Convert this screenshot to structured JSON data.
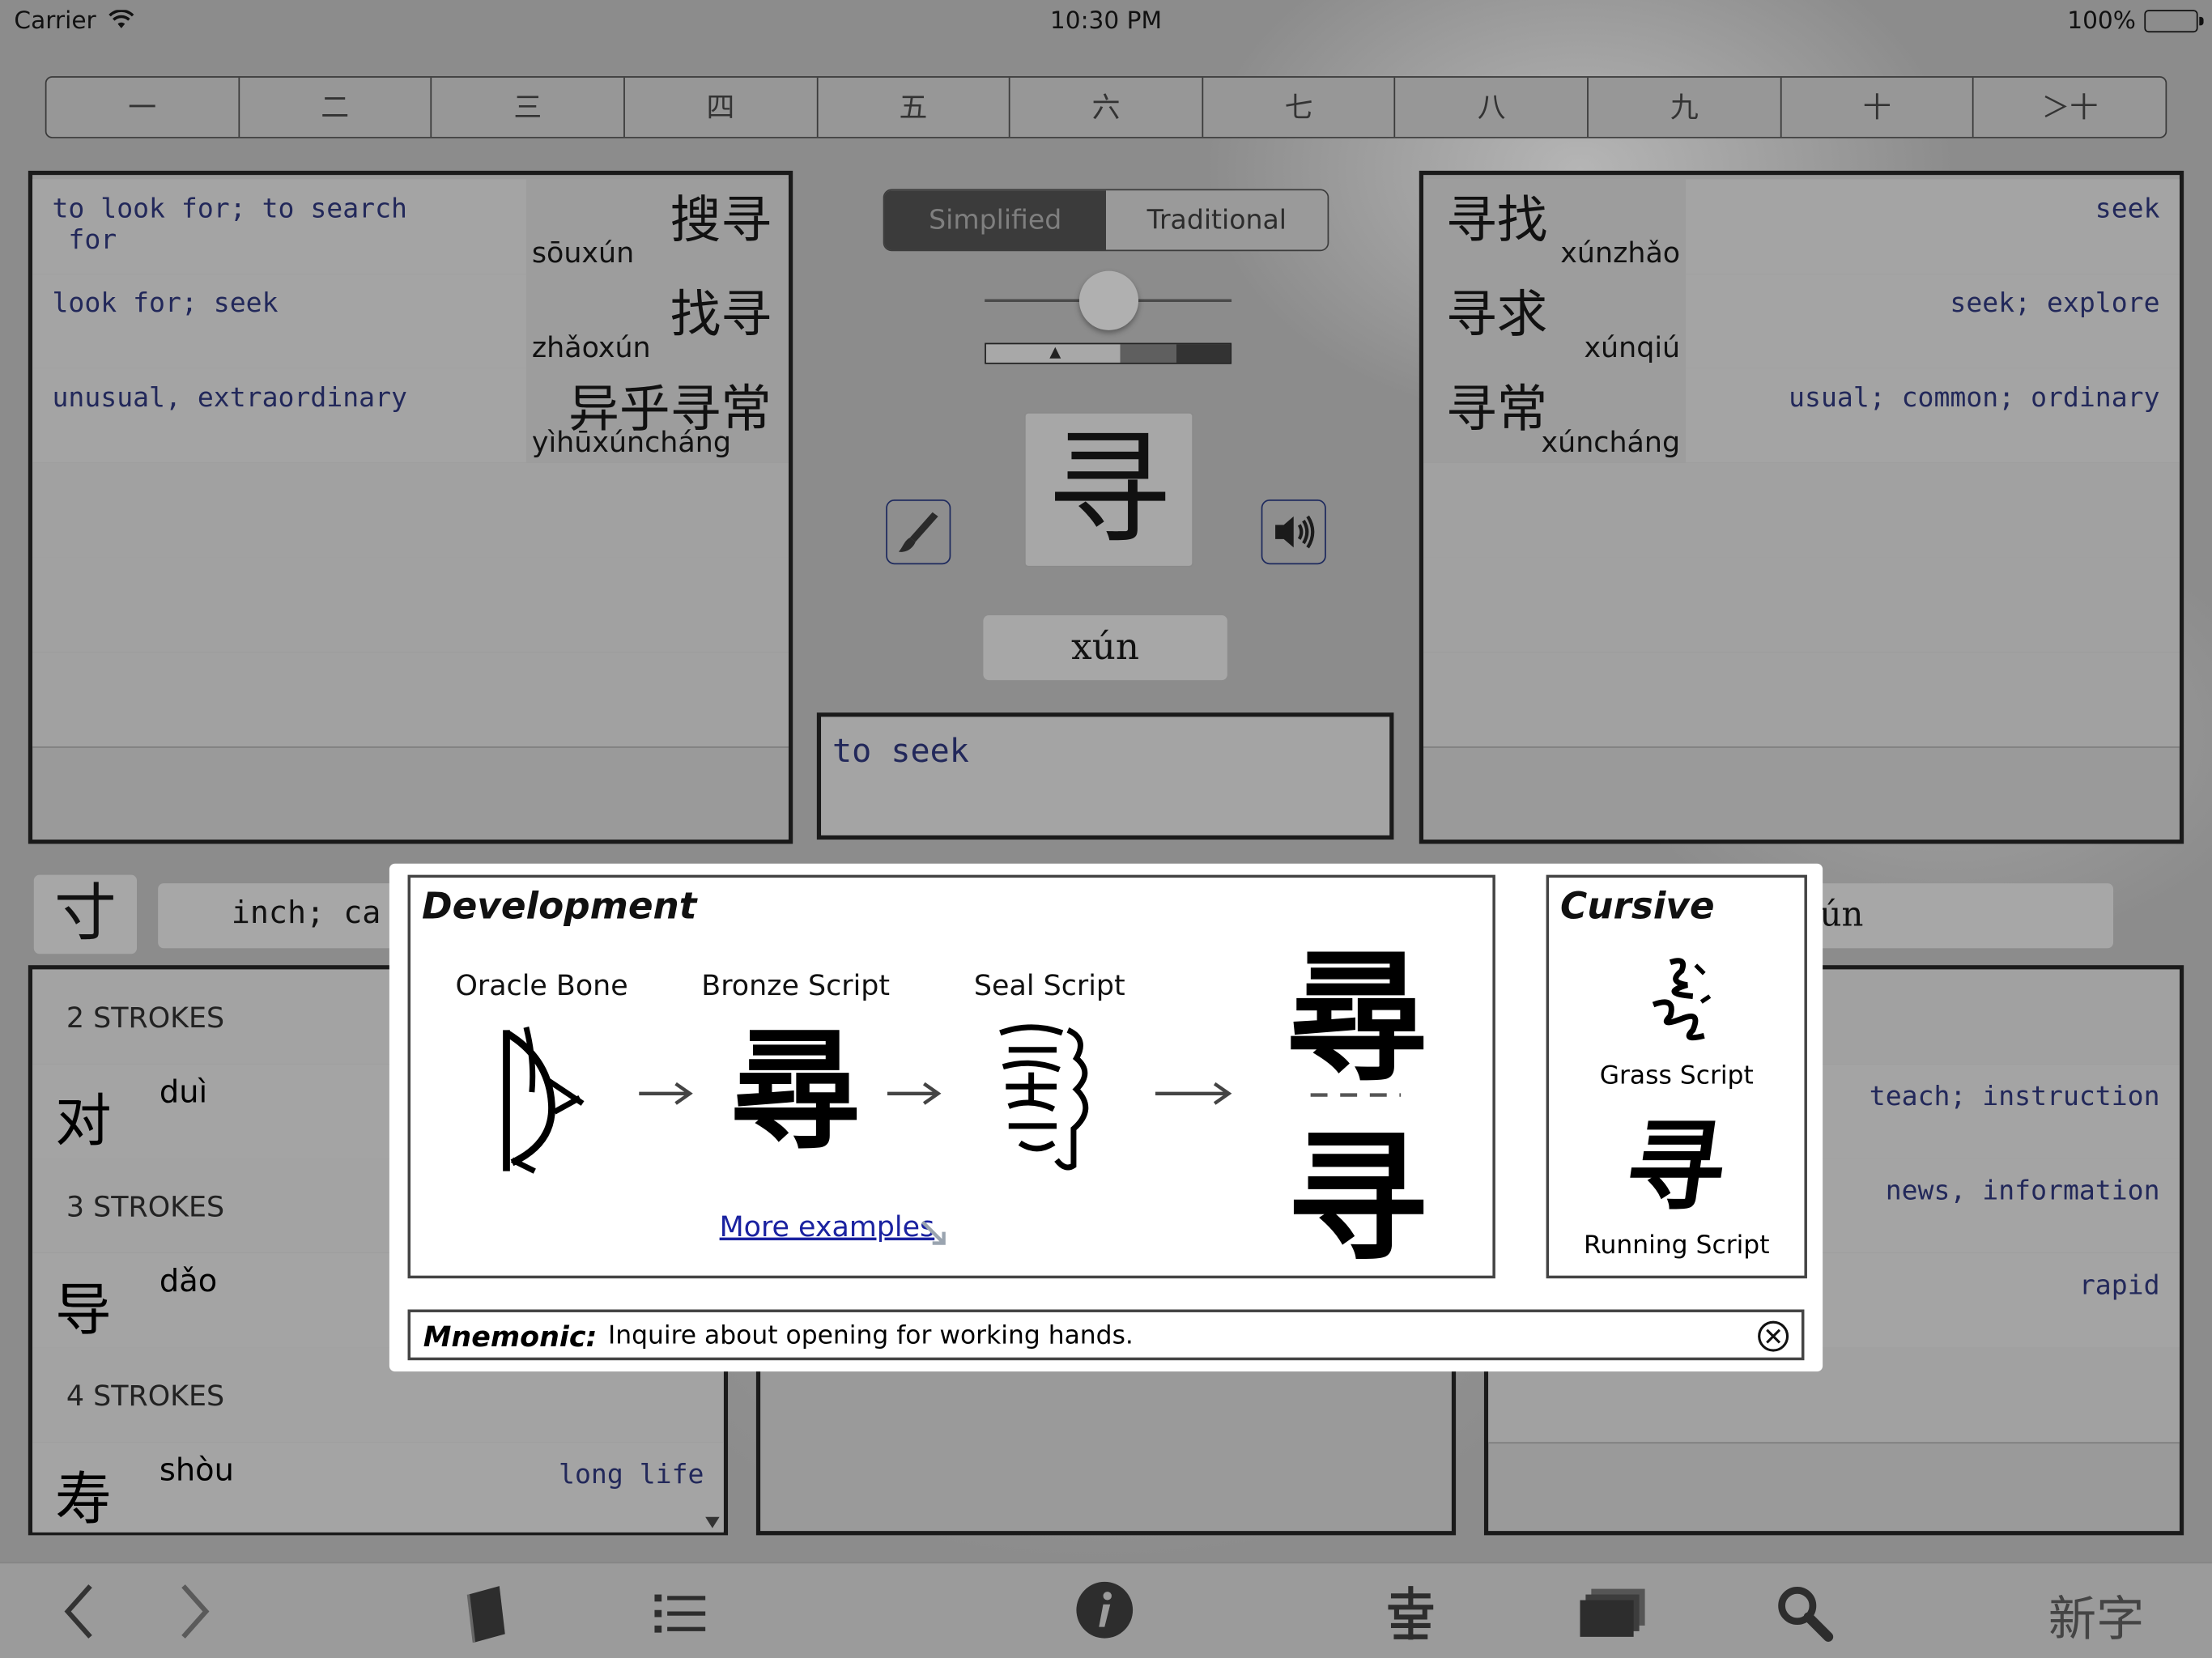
{
  "status": {
    "carrier": "Carrier",
    "time": "10:30 PM",
    "battery": "100%"
  },
  "tabs": [
    "一",
    "二",
    "三",
    "四",
    "五",
    "六",
    "七",
    "八",
    "九",
    "十",
    "＞十"
  ],
  "left_words": [
    {
      "def": "to look for; to search\n for",
      "hanzi": "搜寻",
      "pinyin": "sōuxún"
    },
    {
      "def": "look for; seek",
      "hanzi": "找寻",
      "pinyin": "zhǎoxún"
    },
    {
      "def": "unusual, extraordinary",
      "hanzi": "异乎寻常",
      "pinyin": "yìhūxúncháng"
    }
  ],
  "right_words": [
    {
      "hanzi": "寻找",
      "pinyin": "xúnzhǎo",
      "def": "seek"
    },
    {
      "hanzi": "寻求",
      "pinyin": "xúnqiú",
      "def": "seek; explore"
    },
    {
      "hanzi": "寻常",
      "pinyin": "xúncháng",
      "def": "usual; common; ordinary"
    }
  ],
  "center": {
    "segment": {
      "simplified": "Simplified",
      "traditional": "Traditional"
    },
    "slider_value": 0.5,
    "character": "寻",
    "pinyin": "xún",
    "definition": "to seek"
  },
  "radical": {
    "char": "寸",
    "def": "inch; ca",
    "right_fragment": "ún"
  },
  "strokes_list": [
    {
      "type": "header",
      "label": "2 STROKES"
    },
    {
      "type": "item",
      "char": "对",
      "pinyin": "duì",
      "def": ""
    },
    {
      "type": "header",
      "label": "3 STROKES"
    },
    {
      "type": "item",
      "char": "导",
      "pinyin": "dǎo",
      "def": ""
    },
    {
      "type": "header",
      "label": "4 STROKES"
    },
    {
      "type": "item",
      "char": "寿",
      "pinyin": "shòu",
      "def": "long life"
    }
  ],
  "bottom_right_defs": [
    "teach; instruction",
    "news, information",
    "rapid"
  ],
  "overlay": {
    "development_title": "Development",
    "stages": [
      "Oracle Bone",
      "Bronze Script",
      "Seal Script"
    ],
    "modern_traditional": "尋",
    "modern_simplified": "寻",
    "more_examples": "More examples",
    "cursive_title": "Cursive",
    "grass_label": "Grass Script",
    "running_label": "Running Script",
    "running_glyph": "寻",
    "mnemonic_label": "Mnemonic:",
    "mnemonic_text": "Inquire about opening for working hands."
  },
  "toolbar": {
    "new_chars": "新字"
  },
  "colors": {
    "definition_text": "#22285a",
    "link": "#1a22a0",
    "button_outline": "#1e2a5e"
  },
  "icons": [
    "wifi-icon",
    "battery-icon",
    "brush-icon",
    "speaker-icon",
    "arrow-right-icon",
    "resize-arrow-icon",
    "close-circle-icon",
    "back-chevron-icon",
    "forward-chevron-icon",
    "book-icon",
    "list-icon",
    "info-icon",
    "radical-icon",
    "cards-icon",
    "search-icon",
    "scroll-down-icon"
  ]
}
